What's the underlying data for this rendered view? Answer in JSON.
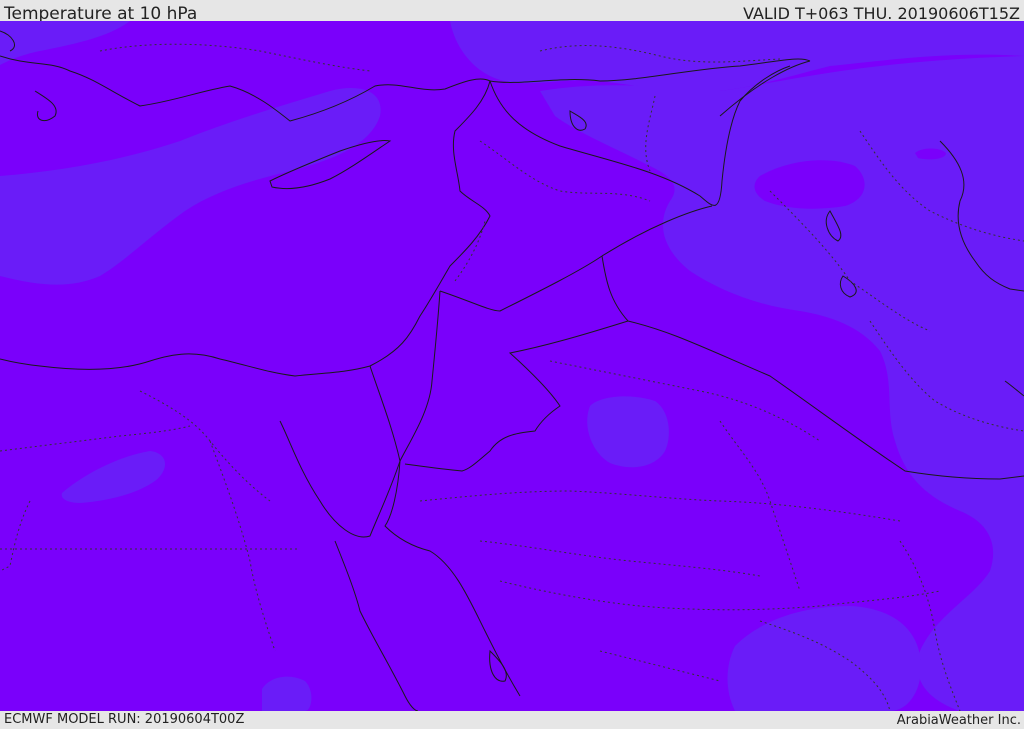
{
  "header": {
    "title": "Temperature at 10 hPa",
    "valid": "VALID T+063 THU. 20190606T15Z"
  },
  "footer": {
    "model_run": "ECMWF MODEL RUN: 20190604T00Z",
    "credit": "ArabiaWeather Inc."
  },
  "map": {
    "colors": {
      "field_main": "#7a00fb",
      "field_cooler": "#6a1cf8",
      "coastline": "#1a1a1a",
      "border": "#1a1a1a"
    }
  }
}
